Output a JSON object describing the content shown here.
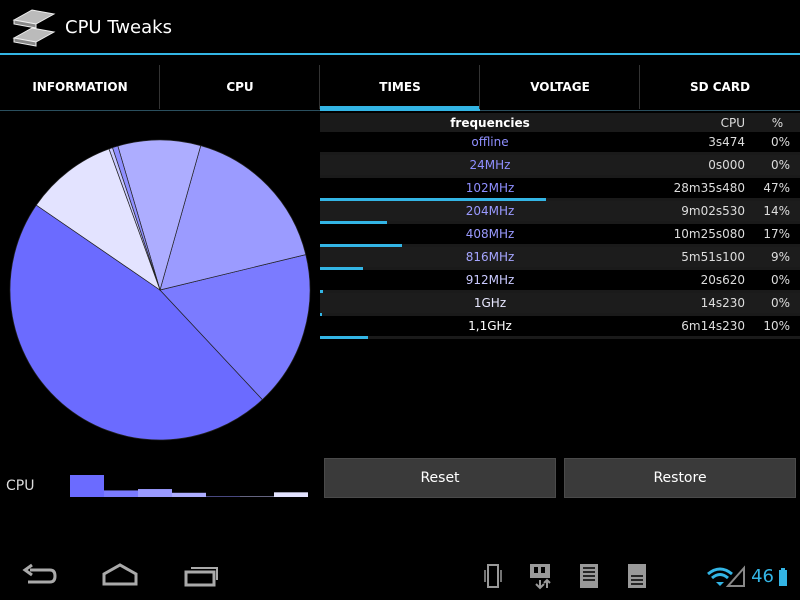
{
  "app": {
    "title": "CPU Tweaks",
    "icon": "cpu-tweaks-app-icon"
  },
  "tabs": [
    {
      "label": "INFORMATION",
      "active": false
    },
    {
      "label": "CPU",
      "active": false
    },
    {
      "label": "TIMES",
      "active": true
    },
    {
      "label": "VOLTAGE",
      "active": false
    },
    {
      "label": "SD CARD",
      "active": false
    }
  ],
  "table": {
    "headers": {
      "freq": "frequencies",
      "cpu": "CPU",
      "pct": "%"
    },
    "rows": [
      {
        "freq": "offline",
        "time": "3s474",
        "pct": "0%",
        "value": 0
      },
      {
        "freq": "24MHz",
        "time": "0s000",
        "pct": "0%",
        "value": 0
      },
      {
        "freq": "102MHz",
        "time": "28m35s480",
        "pct": "47%",
        "value": 47
      },
      {
        "freq": "204MHz",
        "time": "9m02s530",
        "pct": "14%",
        "value": 14
      },
      {
        "freq": "408MHz",
        "time": "10m25s080",
        "pct": "17%",
        "value": 17
      },
      {
        "freq": "816MHz",
        "time": "5m51s100",
        "pct": "9%",
        "value": 9
      },
      {
        "freq": "912MHz",
        "time": "20s620",
        "pct": "0%",
        "value": 0.6
      },
      {
        "freq": "1GHz",
        "time": "14s230",
        "pct": "0%",
        "value": 0.4
      },
      {
        "freq": "1,1GHz",
        "time": "6m14s230",
        "pct": "10%",
        "value": 10
      }
    ]
  },
  "chart_label": "CPU",
  "buttons": {
    "reset": "Reset",
    "restore": "Restore"
  },
  "status": {
    "clock": "46"
  },
  "colors": {
    "accent": "#33b5e5",
    "slices": [
      "#6b6bff",
      "#7b7bff",
      "#9b9bff",
      "#adadff",
      "#8f8fff",
      "#c8c8ff",
      "#b5b5ff",
      "#e3e3ff"
    ]
  }
}
